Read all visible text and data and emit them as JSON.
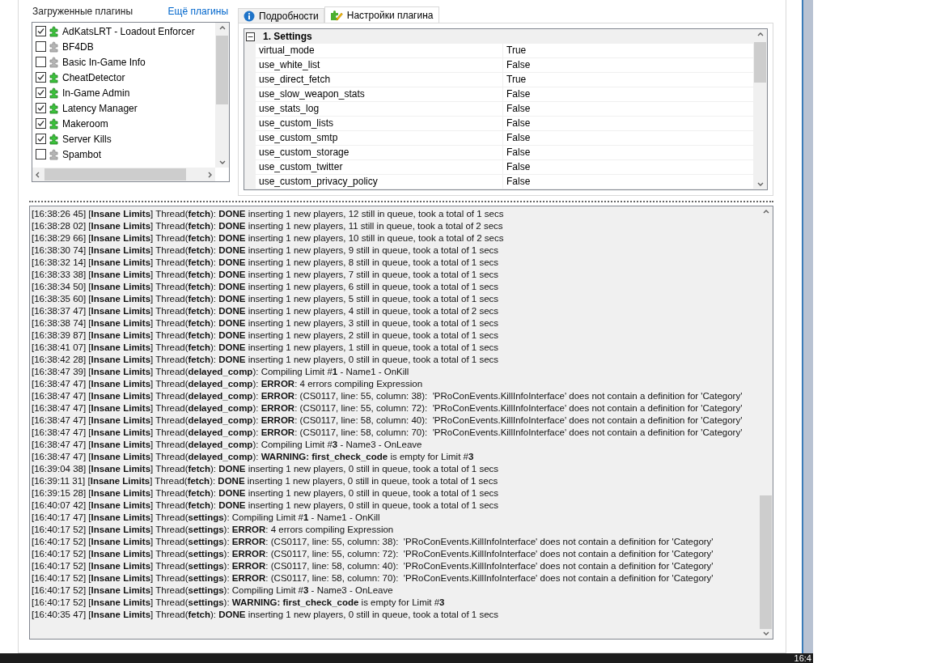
{
  "plugins": {
    "title": "Загруженные плагины",
    "more_link": "Ещё плагины",
    "items": [
      {
        "name": "AdKatsLRT - Loadout Enforcer",
        "checked": true
      },
      {
        "name": "BF4DB",
        "checked": false
      },
      {
        "name": "Basic In-Game Info",
        "checked": false
      },
      {
        "name": "CheatDetector",
        "checked": true
      },
      {
        "name": "In-Game Admin",
        "checked": true
      },
      {
        "name": "Latency Manager",
        "checked": true
      },
      {
        "name": "Makeroom",
        "checked": true
      },
      {
        "name": "Server Kills",
        "checked": true
      },
      {
        "name": "Spambot",
        "checked": false
      }
    ]
  },
  "tabs": [
    {
      "label": "Подробности",
      "kind": "info",
      "selected": false
    },
    {
      "label": "Настройки плагина",
      "kind": "settings",
      "selected": true
    }
  ],
  "settings": {
    "group": "1. Settings",
    "expanded": true,
    "rows": [
      {
        "name": "virtual_mode",
        "value": "True"
      },
      {
        "name": "use_white_list",
        "value": "False"
      },
      {
        "name": "use_direct_fetch",
        "value": "True"
      },
      {
        "name": "use_slow_weapon_stats",
        "value": "False"
      },
      {
        "name": "use_stats_log",
        "value": "False"
      },
      {
        "name": "use_custom_lists",
        "value": "False"
      },
      {
        "name": "use_custom_smtp",
        "value": "False"
      },
      {
        "name": "use_custom_storage",
        "value": "False"
      },
      {
        "name": "use_custom_twitter",
        "value": "False"
      },
      {
        "name": "use_custom_privacy_policy",
        "value": "False"
      }
    ]
  },
  "log": [
    "[16:38:26 45] [**Insane Limits**] Thread(**fetch**): **DONE** inserting 1 new players, 12 still in queue, took a total of 1 secs",
    "[16:38:28 02] [**Insane Limits**] Thread(**fetch**): **DONE** inserting 1 new players, 11 still in queue, took a total of 2 secs",
    "[16:38:29 66] [**Insane Limits**] Thread(**fetch**): **DONE** inserting 1 new players, 10 still in queue, took a total of 2 secs",
    "[16:38:30 74] [**Insane Limits**] Thread(**fetch**): **DONE** inserting 1 new players, 9 still in queue, took a total of 1 secs",
    "[16:38:32 14] [**Insane Limits**] Thread(**fetch**): **DONE** inserting 1 new players, 8 still in queue, took a total of 1 secs",
    "[16:38:33 38] [**Insane Limits**] Thread(**fetch**): **DONE** inserting 1 new players, 7 still in queue, took a total of 1 secs",
    "[16:38:34 50] [**Insane Limits**] Thread(**fetch**): **DONE** inserting 1 new players, 6 still in queue, took a total of 1 secs",
    "[16:38:35 60] [**Insane Limits**] Thread(**fetch**): **DONE** inserting 1 new players, 5 still in queue, took a total of 1 secs",
    "[16:38:37 47] [**Insane Limits**] Thread(**fetch**): **DONE** inserting 1 new players, 4 still in queue, took a total of 2 secs",
    "[16:38:38 74] [**Insane Limits**] Thread(**fetch**): **DONE** inserting 1 new players, 3 still in queue, took a total of 1 secs",
    "[16:38:39 87] [**Insane Limits**] Thread(**fetch**): **DONE** inserting 1 new players, 2 still in queue, took a total of 1 secs",
    "[16:38:41 07] [**Insane Limits**] Thread(**fetch**): **DONE** inserting 1 new players, 1 still in queue, took a total of 1 secs",
    "[16:38:42 28] [**Insane Limits**] Thread(**fetch**): **DONE** inserting 1 new players, 0 still in queue, took a total of 1 secs",
    "[16:38:47 39] [**Insane Limits**] Thread(**delayed_comp**): Compiling Limit #**1** - Name1 - OnKill",
    "[16:38:47 47] [**Insane Limits**] Thread(**delayed_comp**): **ERROR**: 4 errors compiling Expression",
    "[16:38:47 47] [**Insane Limits**] Thread(**delayed_comp**): **ERROR**: (CS0117, line: 55, column: 38):  'PRoConEvents.KillInfoInterface' does not contain a definition for 'Category'",
    "[16:38:47 47] [**Insane Limits**] Thread(**delayed_comp**): **ERROR**: (CS0117, line: 55, column: 72):  'PRoConEvents.KillInfoInterface' does not contain a definition for 'Category'",
    "[16:38:47 47] [**Insane Limits**] Thread(**delayed_comp**): **ERROR**: (CS0117, line: 58, column: 40):  'PRoConEvents.KillInfoInterface' does not contain a definition for 'Category'",
    "[16:38:47 47] [**Insane Limits**] Thread(**delayed_comp**): **ERROR**: (CS0117, line: 58, column: 70):  'PRoConEvents.KillInfoInterface' does not contain a definition for 'Category'",
    "[16:38:47 47] [**Insane Limits**] Thread(**delayed_comp**): Compiling Limit #**3** - Name3 - OnLeave",
    "[16:38:47 47] [**Insane Limits**] Thread(**delayed_comp**): **WARNING: first_check_code** is empty for Limit #**3**",
    "[16:39:04 38] [**Insane Limits**] Thread(**fetch**): **DONE** inserting 1 new players, 0 still in queue, took a total of 1 secs",
    "[16:39:11 31] [**Insane Limits**] Thread(**fetch**): **DONE** inserting 1 new players, 0 still in queue, took a total of 1 secs",
    "[16:39:15 28] [**Insane Limits**] Thread(**fetch**): **DONE** inserting 1 new players, 0 still in queue, took a total of 1 secs",
    "[16:40:07 42] [**Insane Limits**] Thread(**fetch**): **DONE** inserting 1 new players, 0 still in queue, took a total of 1 secs",
    "[16:40:17 47] [**Insane Limits**] Thread(**settings**): Compiling Limit #**1** - Name1 - OnKill",
    "[16:40:17 52] [**Insane Limits**] Thread(**settings**): **ERROR**: 4 errors compiling Expression",
    "[16:40:17 52] [**Insane Limits**] Thread(**settings**): **ERROR**: (CS0117, line: 55, column: 38):  'PRoConEvents.KillInfoInterface' does not contain a definition for 'Category'",
    "[16:40:17 52] [**Insane Limits**] Thread(**settings**): **ERROR**: (CS0117, line: 55, column: 72):  'PRoConEvents.KillInfoInterface' does not contain a definition for 'Category'",
    "[16:40:17 52] [**Insane Limits**] Thread(**settings**): **ERROR**: (CS0117, line: 58, column: 40):  'PRoConEvents.KillInfoInterface' does not contain a definition for 'Category'",
    "[16:40:17 52] [**Insane Limits**] Thread(**settings**): **ERROR**: (CS0117, line: 58, column: 70):  'PRoConEvents.KillInfoInterface' does not contain a definition for 'Category'",
    "[16:40:17 52] [**Insane Limits**] Thread(**settings**): Compiling Limit #**3** - Name3 - OnLeave",
    "[16:40:17 52] [**Insane Limits**] Thread(**settings**): **WARNING: first_check_code** is empty for Limit #**3**",
    "[16:40:35 47] [**Insane Limits**] Thread(**fetch**): **DONE** inserting 1 new players, 0 still in queue, took a total of 1 secs"
  ],
  "taskbar": {
    "clock": "16:4"
  }
}
